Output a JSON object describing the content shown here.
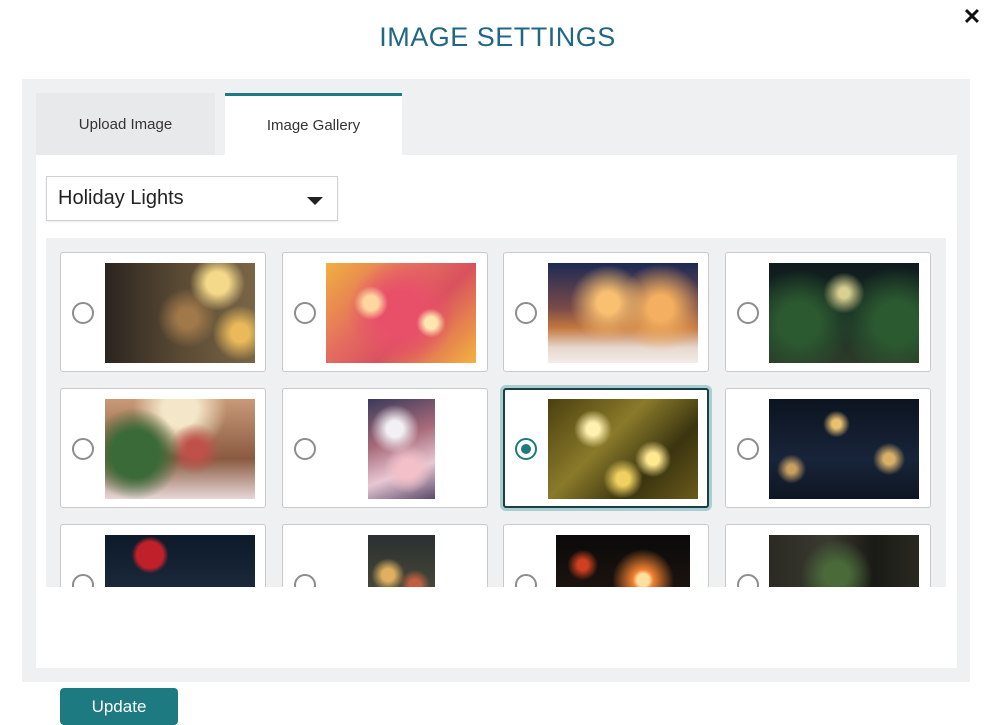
{
  "dialog": {
    "title": "IMAGE SETTINGS",
    "close_glyph": "✕",
    "close_icon": "close-icon"
  },
  "tabs": [
    {
      "label": "Upload Image",
      "active": false
    },
    {
      "label": "Image Gallery",
      "active": true
    }
  ],
  "category_select": {
    "value": "Holiday Lights",
    "icon": "caret-down-icon"
  },
  "gallery": {
    "selected_index": 6,
    "images": [
      {
        "name": "phone-photo-city-lights"
      },
      {
        "name": "red-gold-bokeh"
      },
      {
        "name": "snowy-park-lit-trees"
      },
      {
        "name": "street-lights-snow"
      },
      {
        "name": "christmas-trees-market"
      },
      {
        "name": "snowy-branches-lights"
      },
      {
        "name": "gold-string-lights"
      },
      {
        "name": "starburst-lights-night"
      },
      {
        "name": "red-ornament-bokeh"
      },
      {
        "name": "christmas-market-stall"
      },
      {
        "name": "sparkler-night"
      },
      {
        "name": "window-christmas-tree"
      }
    ]
  },
  "actions": {
    "update_label": "Update"
  },
  "colors": {
    "accent": "#1c7a80",
    "title": "#1f6784",
    "panel_bg": "#eff0f2"
  }
}
